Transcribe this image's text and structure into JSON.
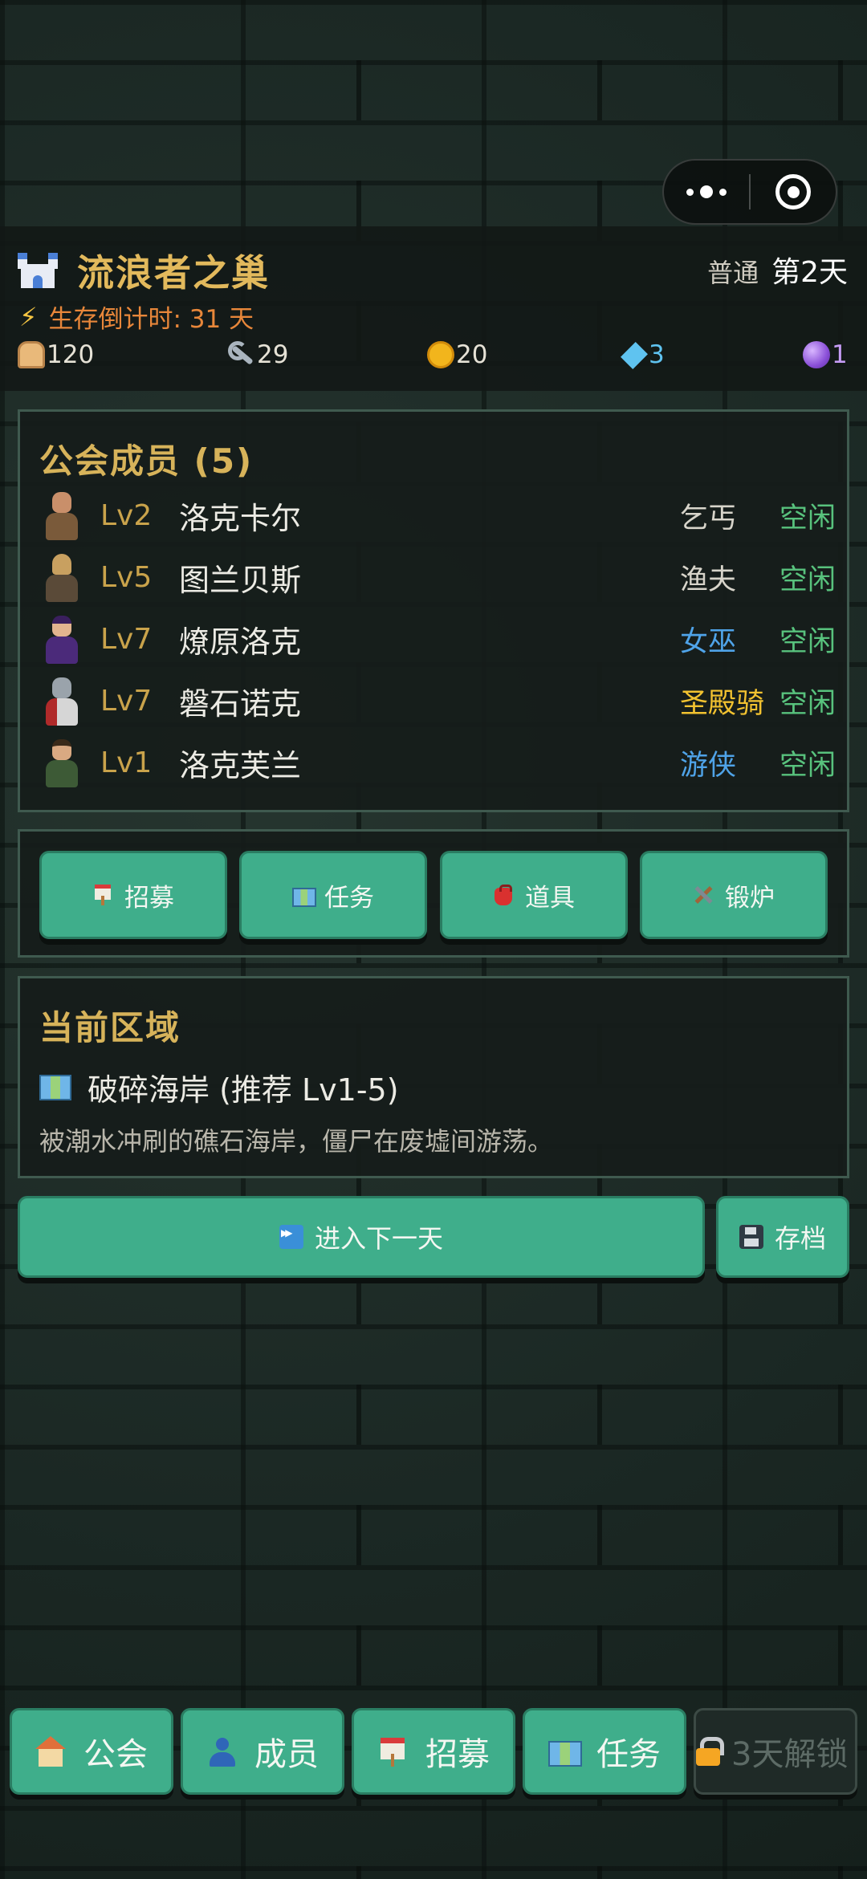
{
  "header": {
    "guild_name": "流浪者之巢",
    "difficulty": "普通",
    "day": "第2天",
    "countdown_label": "生存倒计时: 31 天"
  },
  "resources": [
    {
      "icon": "bread-icon",
      "value": "120"
    },
    {
      "icon": "wrench-icon",
      "value": "29"
    },
    {
      "icon": "coin-icon",
      "value": "20"
    },
    {
      "icon": "gem-icon",
      "value": "3"
    },
    {
      "icon": "crystal-orb-icon",
      "value": "1"
    }
  ],
  "members_panel": {
    "title": "公会成员 (5)",
    "members": [
      {
        "level": "Lv2",
        "name": "洛克卡尔",
        "class": "乞丐",
        "class_color": "#d7d4ca",
        "status": "空闲"
      },
      {
        "level": "Lv5",
        "name": "图兰贝斯",
        "class": "渔夫",
        "class_color": "#d7d4ca",
        "status": "空闲"
      },
      {
        "level": "Lv7",
        "name": "燎原洛克",
        "class": "女巫",
        "class_color": "#4fa3e8",
        "status": "空闲"
      },
      {
        "level": "Lv7",
        "name": "磐石诺克",
        "class": "圣殿骑",
        "class_color": "#f2c230",
        "status": "空闲"
      },
      {
        "level": "Lv1",
        "name": "洛克芙兰",
        "class": "游侠",
        "class_color": "#4fa3e8",
        "status": "空闲"
      }
    ]
  },
  "actions": {
    "recruit": "招募",
    "quest": "任务",
    "items": "道具",
    "forge": "锻炉"
  },
  "region": {
    "title": "当前区域",
    "name": "破碎海岸 (推荐 Lv1-5)",
    "description": "被潮水冲刷的礁石海岸，僵尸在废墟间游荡。"
  },
  "controls": {
    "next_day": "进入下一天",
    "save": "存档"
  },
  "tabs": {
    "guild": "公会",
    "members": "成员",
    "recruit": "招募",
    "quest": "任务",
    "locked": "3天解锁"
  },
  "colors": {
    "accent_green": "#3fae8b",
    "gold_title": "#d7b35a",
    "status_idle": "#58c27d",
    "countdown": "#e8873a"
  }
}
